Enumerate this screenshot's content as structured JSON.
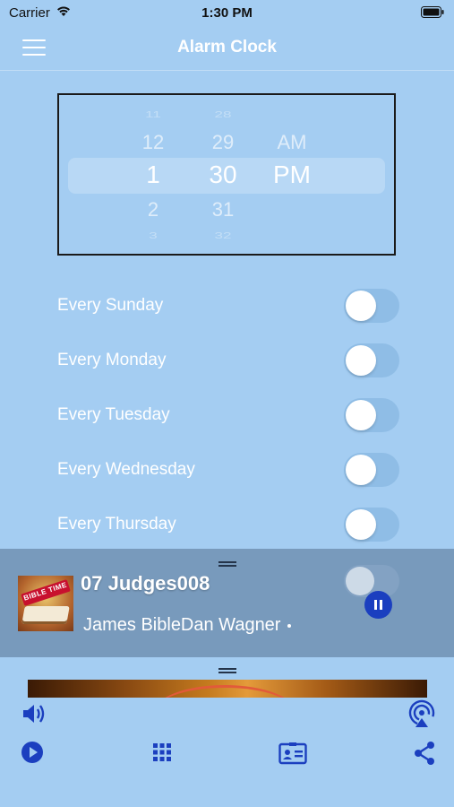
{
  "status_bar": {
    "carrier": "Carrier",
    "time": "1:30 PM"
  },
  "nav": {
    "title": "Alarm Clock",
    "menu_icon": "hamburger-menu-icon"
  },
  "time_picker": {
    "hours": [
      "11",
      "12",
      "1",
      "2",
      "3"
    ],
    "minutes": [
      "28",
      "29",
      "30",
      "31",
      "32"
    ],
    "ampm": [
      "AM",
      "PM"
    ],
    "selected": {
      "hour": "1",
      "minute": "30",
      "ampm": "PM"
    }
  },
  "days": [
    {
      "label": "Every Sunday",
      "enabled": false
    },
    {
      "label": "Every Monday",
      "enabled": false
    },
    {
      "label": "Every Tuesday",
      "enabled": false
    },
    {
      "label": "Every Wednesday",
      "enabled": false
    },
    {
      "label": "Every Thursday",
      "enabled": false
    }
  ],
  "player": {
    "track_title": "07 Judges008",
    "artist": "James BibleDan Wagner",
    "album_art_text": "BIBLE TIME",
    "state": "playing"
  },
  "toolbar": {
    "icons": [
      "volume-icon",
      "airplay-icon",
      "play-icon",
      "grid-icon",
      "contact-card-icon",
      "share-icon"
    ]
  },
  "colors": {
    "background": "#a4cdf2",
    "accent": "#1b3fbf",
    "player_panel": "#6b8cad"
  }
}
